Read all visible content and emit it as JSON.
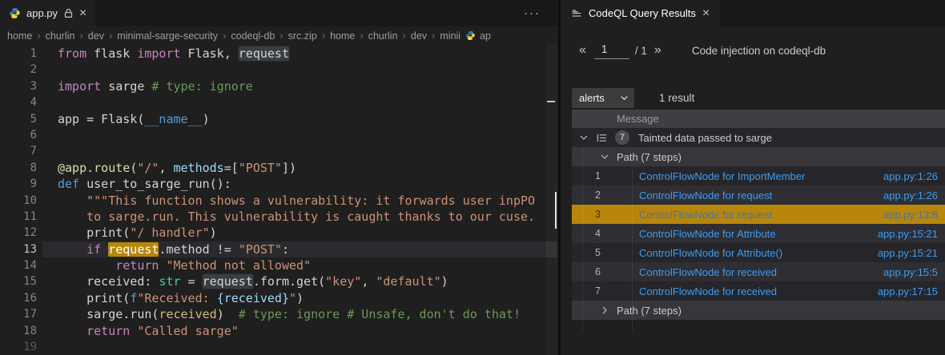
{
  "colors": {
    "bg": "#1f1f1f",
    "tab_strip": "#181818",
    "divider": "#0e0e0e",
    "fg": "#d4d4d4",
    "line_number": "#858585",
    "active_line_number": "#c6c6c6",
    "kw": "#C586C0",
    "fn": "#569CD6",
    "str": "#CE9178",
    "com": "#6A9955",
    "typ": "#4EC9B0",
    "par": "#9CDCFE",
    "dec": "#DCDCAA",
    "gold": "#D7BA7D",
    "word_highlight": "#3a3d41",
    "node_highlight": "#B8860B",
    "active_line_bg": "#2a2a2e",
    "link": "#3F9BF0",
    "link_selected": "#3A77B3",
    "row_a": "#26262a",
    "row_b": "#2e2e33",
    "row_path": "#36363b",
    "row_header": "#3e3e43",
    "row_selected": "#B8860B",
    "badge_bg": "#4d4d50",
    "muted": "#9d9d9d",
    "breadcrumb": "#9d9d9d",
    "python_blue": "#3776AB",
    "python_yellow": "#FFD43B"
  },
  "editor": {
    "tab": {
      "title": "app.py"
    },
    "actions_more": "···",
    "breadcrumb_separator": "›",
    "breadcrumbs": [
      "home",
      "churlin",
      "dev",
      "minimal-sarge-security",
      "codeql-db",
      "src.zip",
      "home",
      "churlin",
      "dev",
      "minii"
    ],
    "breadcrumb_file": "ap",
    "code": {
      "lines": [
        {
          "n": "1",
          "seg": [
            [
              "from",
              "kw"
            ],
            [
              " flask ",
              "pl"
            ],
            [
              "import",
              "kw"
            ],
            [
              " Flask, ",
              "pl"
            ],
            [
              "request",
              "hlw"
            ]
          ]
        },
        {
          "n": "2",
          "seg": []
        },
        {
          "n": "3",
          "seg": [
            [
              "import",
              "kw"
            ],
            [
              " sarge ",
              "pl"
            ],
            [
              "# type: ignore",
              "com"
            ]
          ]
        },
        {
          "n": "4",
          "seg": []
        },
        {
          "n": "5",
          "seg": [
            [
              "app = Flask(",
              "pl"
            ],
            [
              "__name__",
              "fn"
            ],
            [
              ")",
              "pl"
            ]
          ]
        },
        {
          "n": "6",
          "seg": []
        },
        {
          "n": "7",
          "seg": []
        },
        {
          "n": "8",
          "seg": [
            [
              "@app.route",
              "dec"
            ],
            [
              "(",
              "pl"
            ],
            [
              "\"/\"",
              "str"
            ],
            [
              ", ",
              "pl"
            ],
            [
              "methods",
              "par"
            ],
            [
              "=[",
              "pl"
            ],
            [
              "\"POST\"",
              "str"
            ],
            [
              "])",
              "pl"
            ]
          ]
        },
        {
          "n": "9",
          "seg": [
            [
              "def",
              "fn"
            ],
            [
              " user_to_sarge_run():",
              "pl"
            ]
          ]
        },
        {
          "n": "10",
          "seg": [
            [
              "    ",
              "pl"
            ],
            [
              "\"\"\"This function shows a vulnerability: it forwards user inpPO",
              "str"
            ]
          ]
        },
        {
          "n": "11",
          "seg": [
            [
              "    to sarge.run. This vulnerability is caught thanks to our cuse.",
              "str"
            ]
          ]
        },
        {
          "n": "12",
          "seg": [
            [
              "    print(",
              "pl"
            ],
            [
              "\"/ handler\"",
              "str"
            ],
            [
              ")",
              "pl"
            ]
          ]
        },
        {
          "n": "13",
          "active": true,
          "seg": [
            [
              "    ",
              "pl"
            ],
            [
              "if",
              "kw"
            ],
            [
              " ",
              "pl"
            ],
            [
              "request",
              "hlo"
            ],
            [
              ".method != ",
              "pl"
            ],
            [
              "\"POST\"",
              "str"
            ],
            [
              ":",
              "pl"
            ]
          ]
        },
        {
          "n": "14",
          "seg": [
            [
              "        ",
              "pl"
            ],
            [
              "return",
              "kw"
            ],
            [
              " ",
              "pl"
            ],
            [
              "\"Method not allowed\"",
              "str"
            ]
          ]
        },
        {
          "n": "15",
          "seg": [
            [
              "    received: ",
              "pl"
            ],
            [
              "str",
              "typ"
            ],
            [
              " = ",
              "pl"
            ],
            [
              "request",
              "hlw"
            ],
            [
              ".form.get(",
              "pl"
            ],
            [
              "\"key\"",
              "str"
            ],
            [
              ", ",
              "pl"
            ],
            [
              "\"default\"",
              "str"
            ],
            [
              ")",
              "pl"
            ]
          ]
        },
        {
          "n": "16",
          "seg": [
            [
              "    print(",
              "pl"
            ],
            [
              "f",
              "fn"
            ],
            [
              "\"Received: ",
              "str"
            ],
            [
              "{received}",
              "par"
            ],
            [
              "\"",
              "str"
            ],
            [
              ")",
              "pl"
            ]
          ]
        },
        {
          "n": "17",
          "seg": [
            [
              "    sarge.run(",
              "pl"
            ],
            [
              "received",
              "gold"
            ],
            [
              ")",
              "pl"
            ],
            [
              "  ",
              "pl"
            ],
            [
              "# type: ignore # Unsafe, don't do that!",
              "com"
            ]
          ]
        },
        {
          "n": "18",
          "seg": [
            [
              "    ",
              "pl"
            ],
            [
              "return",
              "kw"
            ],
            [
              " ",
              "pl"
            ],
            [
              "\"Called sarge\"",
              "str"
            ]
          ]
        },
        {
          "n": "19",
          "dim": true,
          "seg": []
        }
      ]
    }
  },
  "panel": {
    "tab": {
      "title": "CodeQL Query Results"
    },
    "pager": {
      "prev": "«",
      "value": "1",
      "total": "/ 1",
      "next": "»",
      "title": "Code injection on codeql-db"
    },
    "toolbar": {
      "select_value": "alerts",
      "count": "1 result"
    },
    "table": {
      "header": "Message",
      "root": {
        "badge": "7",
        "label": "Tainted data passed to sarge"
      },
      "paths": [
        {
          "label": "Path (7 steps)",
          "expanded": true,
          "steps": [
            {
              "n": "1",
              "text": "ControlFlowNode for ImportMember",
              "loc": "app.py:1:26",
              "stripe": "sa"
            },
            {
              "n": "2",
              "text": "ControlFlowNode for request",
              "loc": "app.py:1:26",
              "stripe": "sb"
            },
            {
              "n": "3",
              "text": "ControlFlowNode for request",
              "loc": "app.py:13:8",
              "stripe": "sel"
            },
            {
              "n": "4",
              "text": "ControlFlowNode for Attribute",
              "loc": "app.py:15:21",
              "stripe": "sb"
            },
            {
              "n": "5",
              "text": "ControlFlowNode for Attribute()",
              "loc": "app.py:15:21",
              "stripe": "sa"
            },
            {
              "n": "6",
              "text": "ControlFlowNode for received",
              "loc": "app.py:15:5",
              "stripe": "sb"
            },
            {
              "n": "7",
              "text": "ControlFlowNode for received",
              "loc": "app.py:17:15",
              "stripe": "sa"
            }
          ]
        },
        {
          "label": "Path (7 steps)",
          "expanded": false,
          "steps": []
        }
      ]
    }
  }
}
